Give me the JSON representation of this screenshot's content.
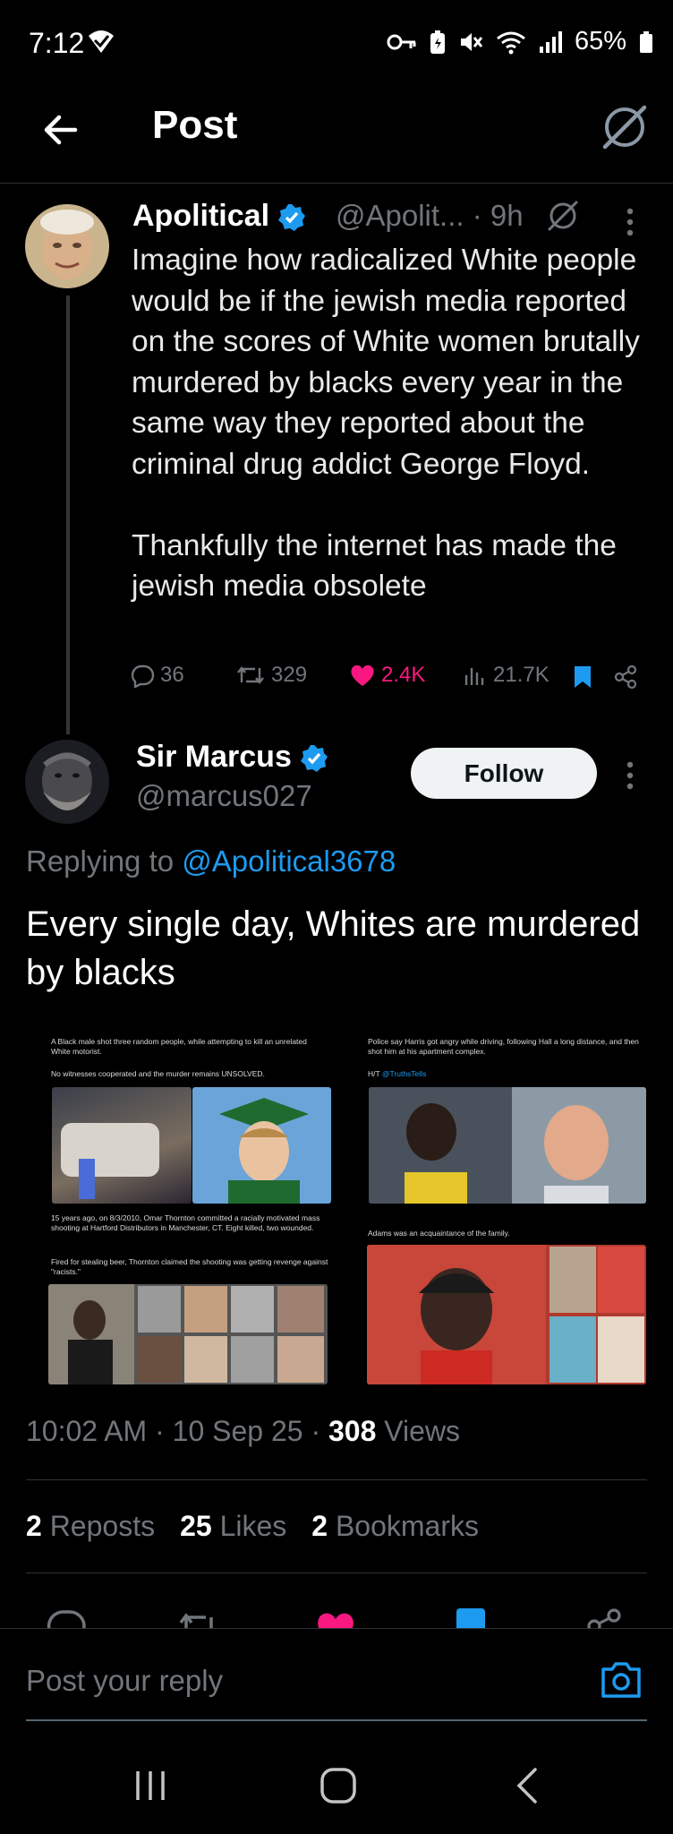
{
  "status_bar": {
    "time": "7:12",
    "battery": "65%",
    "icons": [
      "signal-check-icon",
      "vpn-key-icon",
      "battery-saver-icon",
      "mute-icon",
      "wifi-icon",
      "cell-signal-icon",
      "battery-icon"
    ]
  },
  "header": {
    "title": "Post"
  },
  "tweet1": {
    "name": "Apolitical",
    "handle": "@Apolit...",
    "time": "· 9h",
    "text": "Imagine how radicalized White people would be if the jewish media reported on the scores of White women brutally murdered by blacks every year in the same way they reported about the criminal drug addict George Floyd.\n\nThankfully the internet has made the jewish media obsolete",
    "replies": "36",
    "reposts": "329",
    "likes": "2.4K",
    "views": "21.7K"
  },
  "tweet2": {
    "name": "Sir Marcus",
    "handle": "@marcus027",
    "follow_label": "Follow",
    "replying_prefix": "Replying to ",
    "replying_to": "@Apolitical3678",
    "text": "Every single day, Whites are murdered by blacks",
    "media": {
      "cap_tl_1": "A Black male shot three random people, while attempting to kill an unrelated White motorist.",
      "cap_tl_2": "No witnesses cooperated and the murder remains UNSOLVED.",
      "cap_tr_1": "Police say Harris got angry while driving, following Hall a long distance, and then shot him at his apartment complex.",
      "cap_tr_2": "H/T ",
      "cap_tr_mention": "@TruthsTells",
      "cap_bl_1": "15 years ago, on 8/3/2010, Omar Thornton committed a racially motivated mass shooting at Hartford Distributors in Manchester, CT. Eight killed, two wounded.",
      "cap_bl_2": "Fired for stealing beer, Thornton claimed the shooting was getting revenge against \"racists.\"",
      "cap_br_1": "Adams was an acquaintance of the family."
    },
    "timestamp": "10:02 AM · 10 Sep 25 · ",
    "view_count": "308",
    "views_label": " Views",
    "reposts_count": "2",
    "reposts_label": " Reposts",
    "likes_count": "25",
    "likes_label": " Likes",
    "bookmarks_count": "2",
    "bookmarks_label": " Bookmarks"
  },
  "reply_bar": {
    "placeholder": "Post your reply"
  },
  "colors": {
    "background": "#000000",
    "accent": "#1d9bf0",
    "like": "#f91880",
    "muted": "#71767b",
    "follow_bg": "#eff3f4"
  }
}
